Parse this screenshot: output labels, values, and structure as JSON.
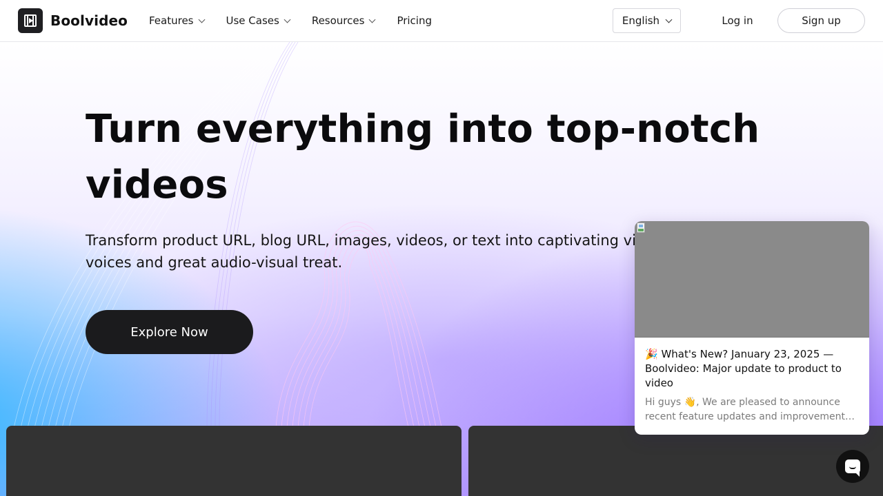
{
  "brand": {
    "name": "Boolvideo"
  },
  "nav": {
    "items": [
      {
        "label": "Features",
        "dropdown": true
      },
      {
        "label": "Use Cases",
        "dropdown": true
      },
      {
        "label": "Resources",
        "dropdown": true
      },
      {
        "label": "Pricing",
        "dropdown": false
      }
    ],
    "language": "English",
    "login_label": "Log in",
    "signup_label": "Sign up"
  },
  "hero": {
    "headline": "Turn everything into top-notch videos",
    "subtitle": "Transform product URL, blog URL, images, videos, or text into captivating videos with AI voices and great audio-visual treat.",
    "cta_label": "Explore Now"
  },
  "notice": {
    "title": "🎉 What's New? January 23, 2025 — Boolvideo: Major update to product to video",
    "text": "Hi guys 👋, We are pleased to announce recent feature updates and improvements to Boolvideo"
  },
  "icons": {
    "logo": "video-frame-play-icon",
    "chevron": "chevron-down-icon",
    "chat": "chat-bubble-icon",
    "broken_image": "broken-image-icon"
  },
  "colors": {
    "primary_dark": "#1b1b1d",
    "gradient_blue": "#32b9ff",
    "gradient_purple": "#966eff",
    "card_dark": "#333333"
  }
}
